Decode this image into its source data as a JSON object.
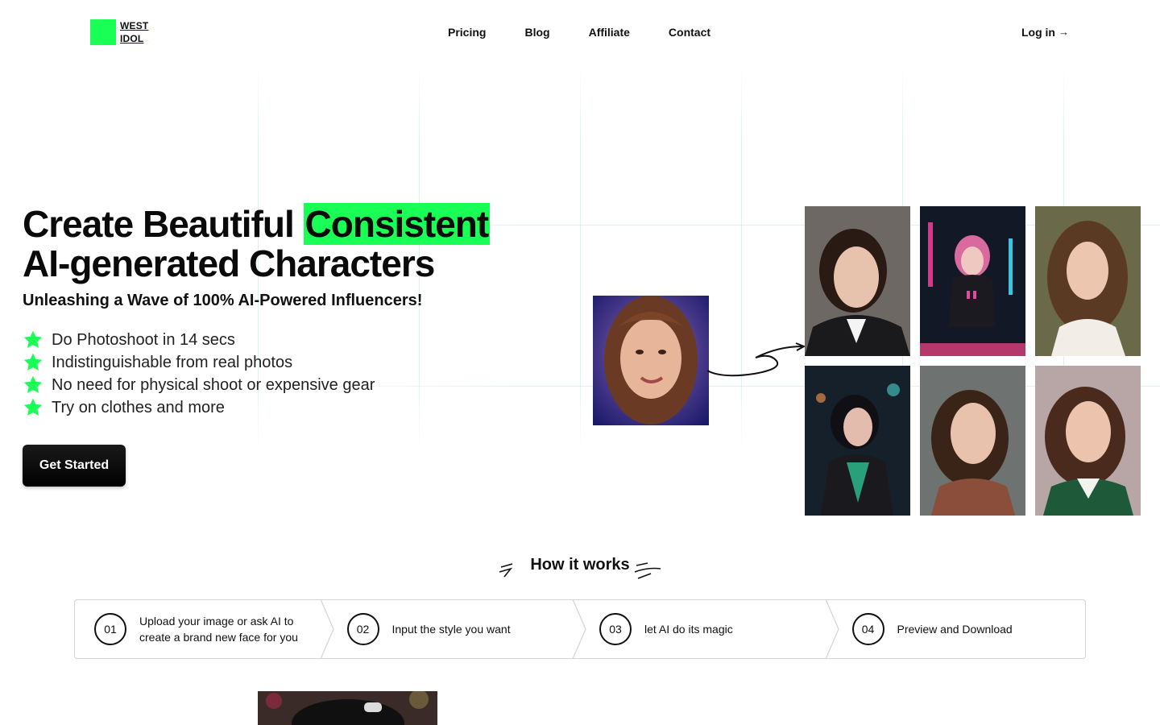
{
  "brand": {
    "line1": "WEST",
    "line2": "IDOL",
    "accent_color": "#19ff56"
  },
  "nav": {
    "items": [
      {
        "label": "Pricing"
      },
      {
        "label": "Blog"
      },
      {
        "label": "Affiliate"
      },
      {
        "label": "Contact"
      }
    ],
    "login_label": "Log in",
    "login_icon": "arrow-right-icon"
  },
  "hero": {
    "title_part1": "Create Beautiful ",
    "title_highlight": "Consistent",
    "title_part2": "AI-generated Characters",
    "subtitle": "Unleashing a Wave of 100% AI-Powered Influencers!",
    "features": [
      {
        "icon": "star-icon",
        "text": "Do Photoshoot in 14 secs"
      },
      {
        "icon": "star-icon",
        "text": "Indistinguishable from real photos"
      },
      {
        "icon": "star-icon",
        "text": "No need for physical shoot or expensive gear"
      },
      {
        "icon": "star-icon",
        "text": "Try on clothes and more"
      }
    ],
    "cta_label": "Get Started"
  },
  "how_it_works": {
    "title": "How it works",
    "steps": [
      {
        "number": "01",
        "text_line1": "Upload your image or ask AI to",
        "text_line2": "create a brand new face for you"
      },
      {
        "number": "02",
        "text_line1": "Input the style you want",
        "text_line2": ""
      },
      {
        "number": "03",
        "text_line1": "let AI do its magic",
        "text_line2": ""
      },
      {
        "number": "04",
        "text_line1": "Preview and Download",
        "text_line2": ""
      }
    ]
  }
}
